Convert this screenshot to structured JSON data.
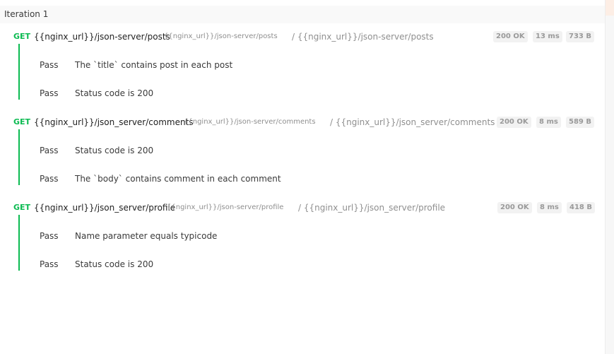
{
  "iteration": {
    "label": "Iteration 1"
  },
  "requests": [
    {
      "method": "GET",
      "url": "{{nginx_url}}/json-server/posts",
      "resolved_url": "{{nginx_url}}/json-server/posts",
      "path": "/ {{nginx_url}}/json-server/posts",
      "status": "200 OK",
      "time": "13 ms",
      "size": "733 B",
      "tests": [
        {
          "status": "Pass",
          "name": "The `title` contains post in each post"
        },
        {
          "status": "Pass",
          "name": "Status code is 200"
        }
      ]
    },
    {
      "method": "GET",
      "url": "{{nginx_url}}/json_server/comments",
      "resolved_url": "{{nginx_url}}/json-server/comments",
      "path": "/ {{nginx_url}}/json_server/comments",
      "status": "200 OK",
      "time": "8 ms",
      "size": "589 B",
      "tests": [
        {
          "status": "Pass",
          "name": "Status code is 200"
        },
        {
          "status": "Pass",
          "name": "The `body` contains comment in each comment"
        }
      ]
    },
    {
      "method": "GET",
      "url": "{{nginx_url}}/json_server/profile",
      "resolved_url": "{{nginx_url}}/json-server/profile",
      "path": "/ {{nginx_url}}/json_server/profile",
      "status": "200 OK",
      "time": "8 ms",
      "size": "418 B",
      "tests": [
        {
          "status": "Pass",
          "name": "Name parameter equals typicode"
        },
        {
          "status": "Pass",
          "name": "Status code is 200"
        }
      ]
    }
  ],
  "colors": {
    "method_get": "#0cbb52",
    "pass_border": "#0cbb52",
    "muted_text": "#8f8f8f",
    "badge_bg": "#f2f2f2",
    "header_bg": "#f9f9f9"
  }
}
